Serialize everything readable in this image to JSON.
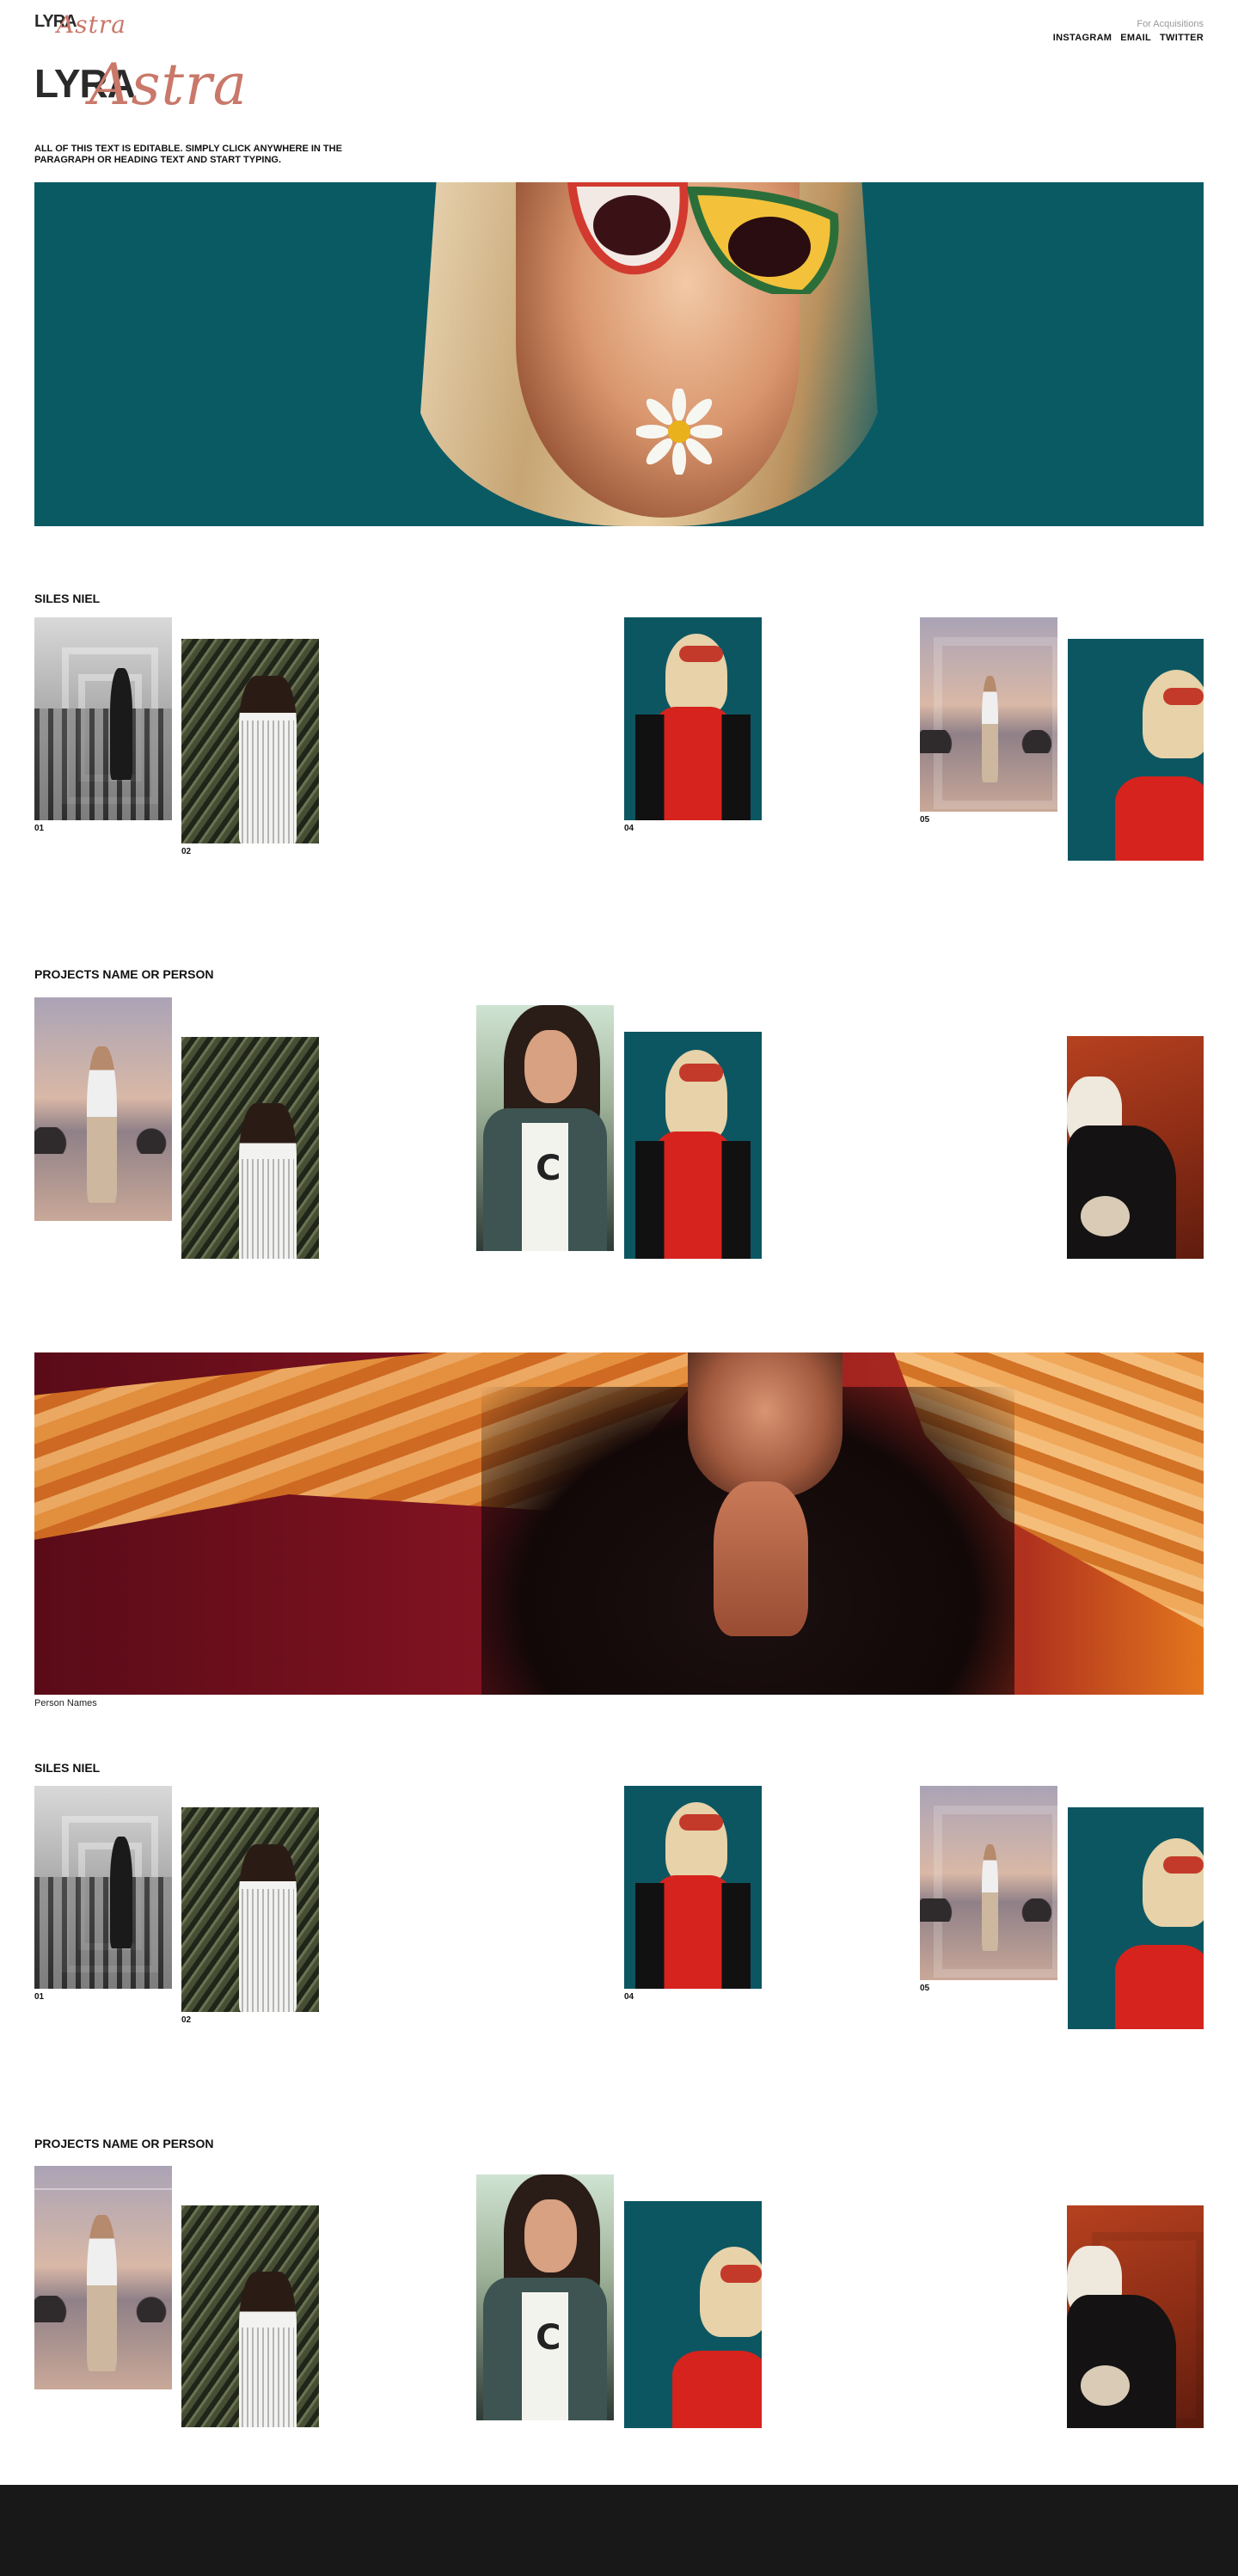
{
  "brand": {
    "lyra": "LYRA",
    "astra": "Astra",
    "colors": {
      "dark": "#2a2a2a",
      "accent": "#c9786a"
    }
  },
  "acquisitions": {
    "label": "For Acquisitions",
    "links": [
      {
        "label": "INSTAGRAM"
      },
      {
        "label": "EMAIL"
      },
      {
        "label": "TWITTER"
      }
    ]
  },
  "intro": "ALL OF THIS TEXT IS EDITABLE. SIMPLY CLICK ANYWHERE IN THE PARAGRAPH OR HEADING TEXT AND START TYPING.",
  "hero_caption": "Person Names",
  "sections": [
    {
      "title": "SILES NIEL",
      "captions": [
        "01",
        "02",
        "04",
        "05"
      ]
    },
    {
      "title": "PROJECTS NAME OR PERSON"
    },
    {
      "title": "SILES NIEL",
      "captions": [
        "01",
        "02",
        "04",
        "05"
      ]
    },
    {
      "title": "PROJECTS NAME OR PERSON"
    }
  ],
  "colors": {
    "footer": "#181818",
    "hero_teal": "#0a5a64"
  }
}
